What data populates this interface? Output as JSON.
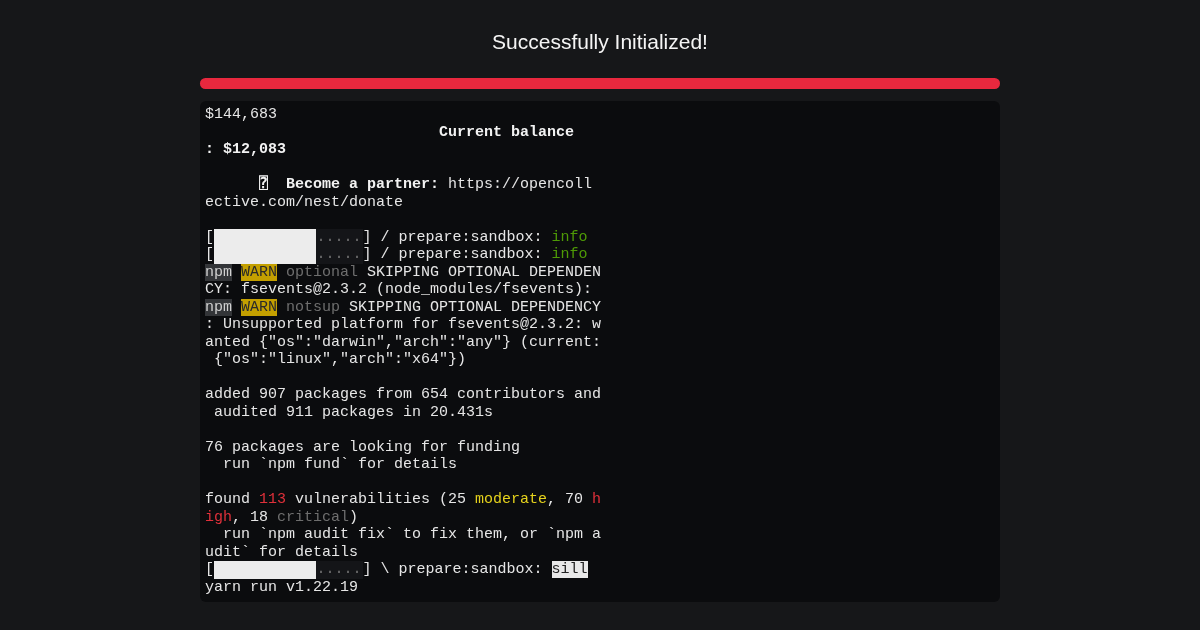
{
  "title": "Successfully Initialized!",
  "progress": {
    "level": 1
  },
  "terminal": {
    "lines": [
      {
        "kind": "text",
        "segments": [
          {
            "kind": "plain",
            "text": "$144,683"
          }
        ]
      },
      {
        "kind": "text",
        "segments": [
          {
            "kind": "bold",
            "text": "                          Current balance"
          }
        ]
      },
      {
        "kind": "text",
        "segments": [
          {
            "kind": "bold",
            "text": ": $12,083"
          }
        ]
      },
      {
        "kind": "blank"
      },
      {
        "kind": "text",
        "segments": [
          {
            "kind": "bold",
            "text": "      ⍰  Become a partner:"
          },
          {
            "kind": "plain",
            "text": " https://opencoll"
          }
        ]
      },
      {
        "kind": "text",
        "segments": [
          {
            "kind": "plain",
            "text": "ective.com/nest/donate"
          }
        ]
      },
      {
        "kind": "blank"
      },
      {
        "kind": "text",
        "segments": [
          {
            "kind": "plain",
            "text": "["
          },
          {
            "kind": "bar",
            "level": 0.69,
            "text": "....."
          },
          {
            "kind": "plain",
            "text": "] / prepare:sandbox: "
          },
          {
            "kind": "green",
            "text": "info"
          }
        ]
      },
      {
        "kind": "text",
        "segments": [
          {
            "kind": "plain",
            "text": "["
          },
          {
            "kind": "bar",
            "level": 0.69,
            "text": "....."
          },
          {
            "kind": "plain",
            "text": "] / prepare:sandbox: "
          },
          {
            "kind": "green",
            "text": "info"
          }
        ]
      },
      {
        "kind": "text",
        "segments": [
          {
            "kind": "npm",
            "text": "npm"
          },
          {
            "kind": "warn",
            "text": "WARN"
          },
          {
            "kind": "dim",
            "text": " optional"
          },
          {
            "kind": "plain",
            "text": " SKIPPING OPTIONAL DEPENDEN"
          }
        ]
      },
      {
        "kind": "text",
        "segments": [
          {
            "kind": "plain",
            "text": "CY: fsevents@2.3.2 (node_modules/fsevents):"
          }
        ]
      },
      {
        "kind": "text",
        "segments": [
          {
            "kind": "npm",
            "text": "npm"
          },
          {
            "kind": "warn",
            "text": "WARN"
          },
          {
            "kind": "dim",
            "text": " notsup"
          },
          {
            "kind": "plain",
            "text": " SKIPPING OPTIONAL DEPENDENCY"
          }
        ]
      },
      {
        "kind": "text",
        "segments": [
          {
            "kind": "plain",
            "text": ": Unsupported platform for fsevents@2.3.2: w"
          }
        ]
      },
      {
        "kind": "text",
        "segments": [
          {
            "kind": "plain",
            "text": "anted {\"os\":\"darwin\",\"arch\":\"any\"} (current:"
          }
        ]
      },
      {
        "kind": "text",
        "segments": [
          {
            "kind": "plain",
            "text": " {\"os\":\"linux\",\"arch\":\"x64\"})"
          }
        ]
      },
      {
        "kind": "blank"
      },
      {
        "kind": "text",
        "segments": [
          {
            "kind": "plain",
            "text": "added 907 packages from 654 contributors and"
          }
        ]
      },
      {
        "kind": "text",
        "segments": [
          {
            "kind": "plain",
            "text": " audited 911 packages in 20.431s"
          }
        ]
      },
      {
        "kind": "blank"
      },
      {
        "kind": "text",
        "segments": [
          {
            "kind": "plain",
            "text": "76 packages are looking for funding"
          }
        ]
      },
      {
        "kind": "text",
        "segments": [
          {
            "kind": "plain",
            "text": "  run `npm fund` for details"
          }
        ]
      },
      {
        "kind": "blank"
      },
      {
        "kind": "text",
        "segments": [
          {
            "kind": "plain",
            "text": "found "
          },
          {
            "kind": "red",
            "text": "113"
          },
          {
            "kind": "plain",
            "text": " vulnerabilities (25 "
          },
          {
            "kind": "yellow",
            "text": "moderate"
          },
          {
            "kind": "plain",
            "text": ", 70 "
          },
          {
            "kind": "red",
            "text": "h"
          }
        ]
      },
      {
        "kind": "text",
        "segments": [
          {
            "kind": "red",
            "text": "igh"
          },
          {
            "kind": "plain",
            "text": ", 18 "
          },
          {
            "kind": "dim",
            "text": "critical"
          },
          {
            "kind": "plain",
            "text": ")"
          }
        ]
      },
      {
        "kind": "text",
        "segments": [
          {
            "kind": "plain",
            "text": "  run `npm audit fix` to fix them, or `npm a"
          }
        ]
      },
      {
        "kind": "text",
        "segments": [
          {
            "kind": "plain",
            "text": "udit` for details"
          }
        ]
      },
      {
        "kind": "text",
        "segments": [
          {
            "kind": "plain",
            "text": "["
          },
          {
            "kind": "bar",
            "level": 0.69,
            "text": "....."
          },
          {
            "kind": "plain",
            "text": "] \\ prepare:sandbox: "
          },
          {
            "kind": "highlight",
            "text": "sill"
          }
        ]
      },
      {
        "kind": "text",
        "segments": [
          {
            "kind": "plain",
            "text": "yarn run v1.22.19"
          }
        ]
      }
    ]
  }
}
